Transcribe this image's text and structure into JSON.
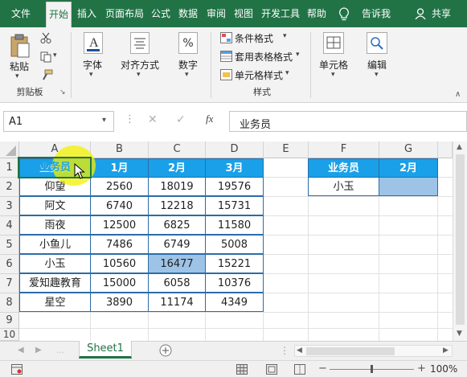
{
  "tabs": [
    "文件",
    "开始",
    "插入",
    "页面布局",
    "公式",
    "数据",
    "审阅",
    "视图",
    "开发工具",
    "帮助"
  ],
  "tell_me": "告诉我",
  "share": "共享",
  "ribbon": {
    "paste": "粘贴",
    "clipboard_group": "剪贴板",
    "font": "字体",
    "alignment": "对齐方式",
    "number": "数字",
    "number_symbol": "%",
    "conditional_format": "条件格式",
    "table_format": "套用表格格式",
    "cell_style": "单元格样式",
    "styles_group": "样式",
    "cells": "单元格",
    "editing": "编辑"
  },
  "formula_bar": {
    "name_box": "A1",
    "fx": "fx",
    "content": "业务员"
  },
  "columns": [
    "A",
    "B",
    "C",
    "D",
    "E",
    "F",
    "G"
  ],
  "rows": [
    "1",
    "2",
    "3",
    "4",
    "5",
    "6",
    "7",
    "8",
    "9",
    "10"
  ],
  "table1": {
    "headers": [
      "业务员",
      "1月",
      "2月",
      "3月"
    ],
    "rows": [
      [
        "仰望",
        "2560",
        "18019",
        "19576"
      ],
      [
        "阿文",
        "6740",
        "12218",
        "15731"
      ],
      [
        "雨夜",
        "12500",
        "6825",
        "11580"
      ],
      [
        "小鱼儿",
        "7486",
        "6749",
        "5008"
      ],
      [
        "小玉",
        "10560",
        "16477",
        "15221"
      ],
      [
        "爱知趣教育",
        "15000",
        "6058",
        "10376"
      ],
      [
        "星空",
        "3890",
        "11174",
        "4349"
      ]
    ]
  },
  "table2": {
    "headers": [
      "业务员",
      "2月"
    ],
    "row": [
      "小玉",
      ""
    ]
  },
  "sheet_tab": "Sheet1",
  "zoom": "100%",
  "colors": {
    "accent": "#217346",
    "header_fill": "#1aa0e8",
    "highlight": "#9dc3e6"
  }
}
